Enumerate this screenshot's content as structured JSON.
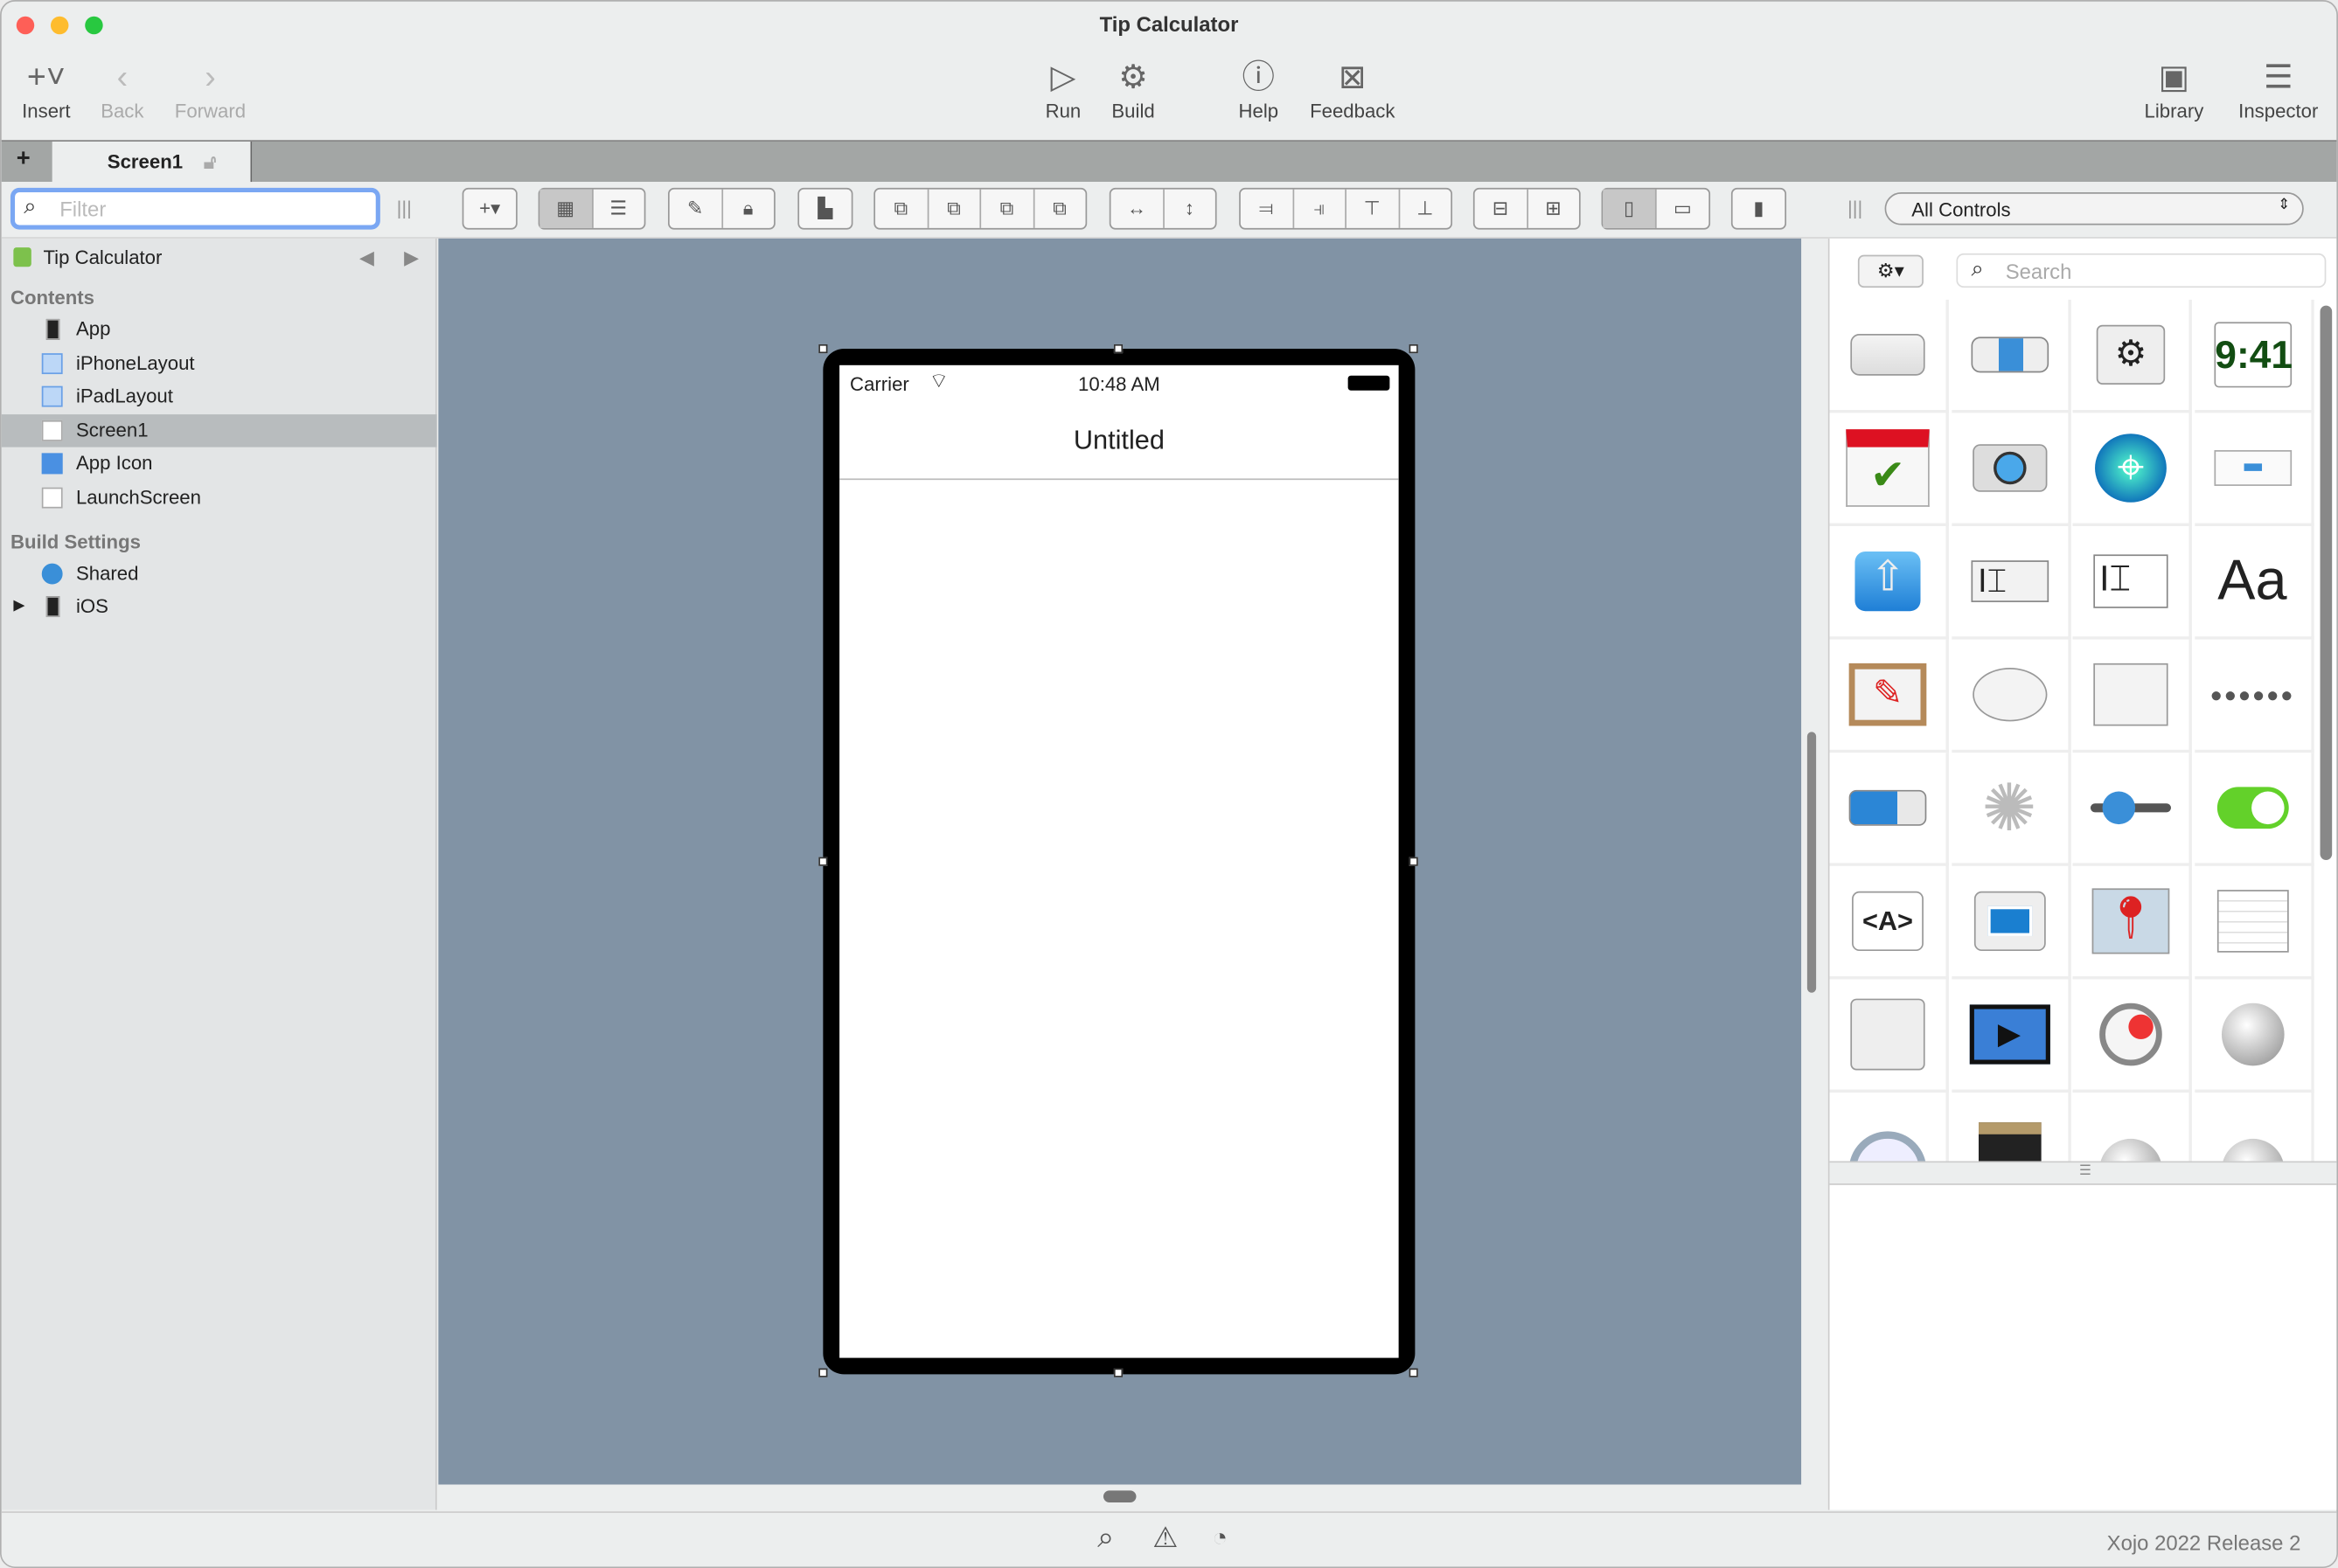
{
  "window": {
    "title": "Tip Calculator"
  },
  "toolbar": {
    "insert": "Insert",
    "back": "Back",
    "forward": "Forward",
    "run": "Run",
    "build": "Build",
    "help": "Help",
    "feedback": "Feedback",
    "library": "Library",
    "inspector": "Inspector"
  },
  "tabs": {
    "add": "+",
    "active": "Screen1"
  },
  "navigator": {
    "filter_placeholder": "Filter",
    "project": "Tip Calculator",
    "contents_header": "Contents",
    "contents": [
      {
        "label": "App"
      },
      {
        "label": "iPhoneLayout"
      },
      {
        "label": "iPadLayout"
      },
      {
        "label": "Screen1",
        "selected": true
      },
      {
        "label": "App Icon"
      },
      {
        "label": "LaunchScreen"
      }
    ],
    "build_header": "Build Settings",
    "build": [
      {
        "label": "Shared"
      },
      {
        "label": "iOS"
      }
    ]
  },
  "layout_editor": {
    "carrier": "Carrier",
    "time": "10:48 AM",
    "nav_title": "Untitled"
  },
  "library": {
    "filter": "All Controls",
    "search_placeholder": "Search",
    "icons": [
      "button-icon",
      "segmented-control-icon",
      "settings-button-icon",
      "date-time-picker-icon",
      "calendar-check-icon",
      "camera-icon",
      "location-icon",
      "message-box-icon",
      "share-icon",
      "text-field-icon",
      "text-area-icon",
      "label-icon",
      "canvas-icon",
      "oval-icon",
      "rectangle-icon",
      "page-indicator-icon",
      "progress-bar-icon",
      "activity-indicator-icon",
      "slider-icon",
      "switch-icon",
      "html-viewer-icon",
      "image-viewer-icon",
      "map-viewer-icon",
      "table-icon",
      "scroll-container-icon",
      "video-player-icon",
      "timer-icon",
      "url-connection-icon",
      "settings-module-icon",
      "thread-icon",
      "globe-icon",
      "globe-icon"
    ]
  },
  "status": {
    "version": "Xojo 2022 Release 2"
  }
}
